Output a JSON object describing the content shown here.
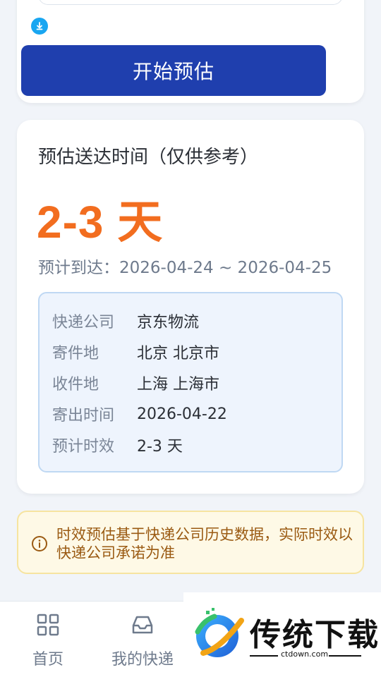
{
  "form": {
    "start_button_label": "开始预估"
  },
  "result": {
    "title": "预估送达时间（仅供参考）",
    "days": "2-3 天",
    "arrival": "预计到达：2026-04-24 ~ 2026-04-25",
    "details": [
      {
        "label": "快递公司",
        "value": "京东物流"
      },
      {
        "label": "寄件地",
        "value": "北京 北京市"
      },
      {
        "label": "收件地",
        "value": "上海 上海市"
      },
      {
        "label": "寄出时间",
        "value": "2026-04-22"
      },
      {
        "label": "预计时效",
        "value": "2-3 天"
      }
    ]
  },
  "notice": {
    "text": "时效预估基于快递公司历史数据，实际时效以快递公司承诺为准"
  },
  "tabbar": {
    "items": [
      {
        "label": "首页",
        "icon": "grid-icon"
      },
      {
        "label": "我的快递",
        "icon": "inbox-icon"
      }
    ]
  },
  "watermark": {
    "brand": "传统下载",
    "url": "ctdown.com"
  },
  "colors": {
    "primary": "#1f3fae",
    "accent": "#f26d1f",
    "notice_bg": "#fef9e6"
  }
}
